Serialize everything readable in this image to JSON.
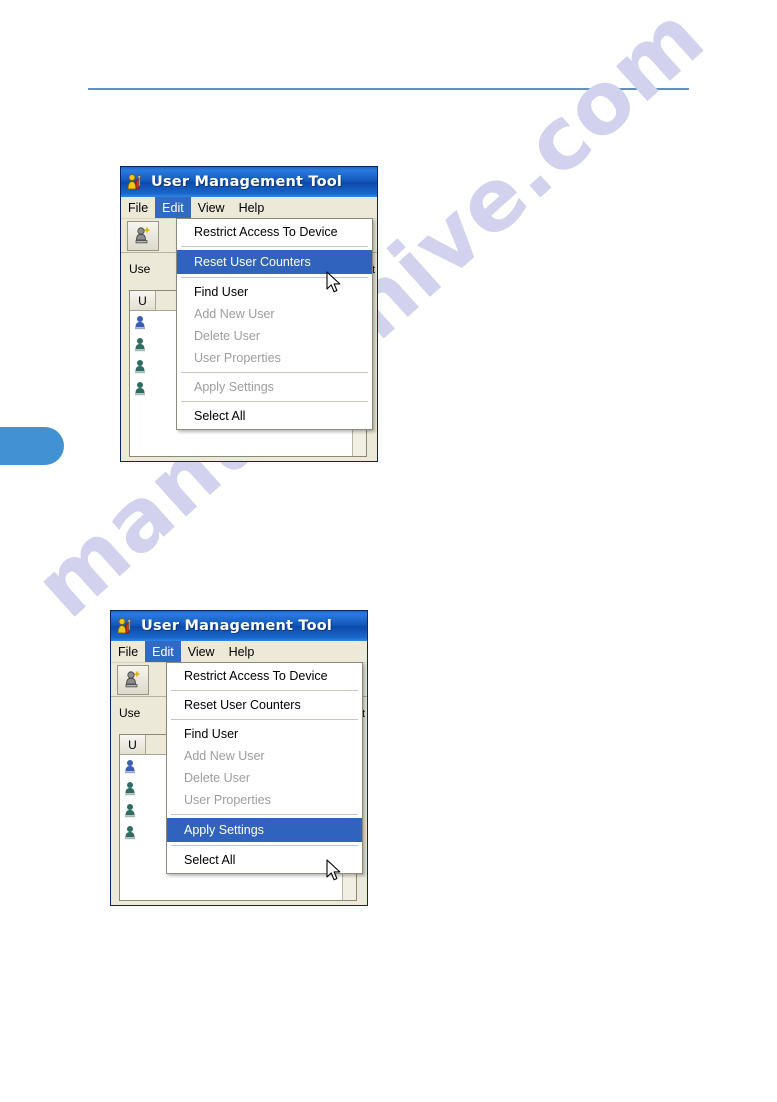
{
  "page": {
    "watermark": "manualshive.com",
    "rule_color": "#5b93c5",
    "tab_color": "#4292d3"
  },
  "window": {
    "title": "User Management Tool",
    "icon": "user-tool-icon",
    "menubar": [
      {
        "label": "File",
        "active": false
      },
      {
        "label": "Edit",
        "active": true
      },
      {
        "label": "View",
        "active": false
      },
      {
        "label": "Help",
        "active": false
      }
    ],
    "toolbar": {
      "add_user_icon": "add-user-icon"
    },
    "list": {
      "panel_label": "Use",
      "column_header": "U",
      "right_edge_char": "t",
      "rows": [
        {
          "icon": "user-icon-blue"
        },
        {
          "icon": "user-icon-green"
        },
        {
          "icon": "user-icon-green"
        },
        {
          "icon": "user-icon-green"
        }
      ]
    },
    "colors": {
      "title_bar": "#0c4aaa",
      "menu_highlight": "#316ac5",
      "menu_selected": "#2f63bd",
      "window_face": "#ece9d8"
    }
  },
  "edit_menu": {
    "items": [
      {
        "label": "Restrict Access To Device",
        "state": "enabled",
        "separator_after": true
      },
      {
        "label": "Reset User Counters",
        "state": "enabled",
        "separator_after": true
      },
      {
        "label": "Find User",
        "state": "enabled",
        "separator_after": false
      },
      {
        "label": "Add New User",
        "state": "disabled",
        "separator_after": false
      },
      {
        "label": "Delete User",
        "state": "disabled",
        "separator_after": false
      },
      {
        "label": "User Properties",
        "state": "disabled",
        "separator_after": true
      },
      {
        "label": "Apply Settings",
        "state": "disabled",
        "separator_after": true
      },
      {
        "label": "Select All",
        "state": "enabled",
        "separator_after": false
      }
    ]
  },
  "screenshots": [
    {
      "id": "screenshot-reset-user-counters",
      "highlighted_item": "Reset User Counters",
      "highlighted_index": 1,
      "cursor": "arrow-pointer"
    },
    {
      "id": "screenshot-apply-settings",
      "highlighted_item": "Apply Settings",
      "highlighted_index": 6,
      "cursor": "arrow-pointer"
    }
  ]
}
